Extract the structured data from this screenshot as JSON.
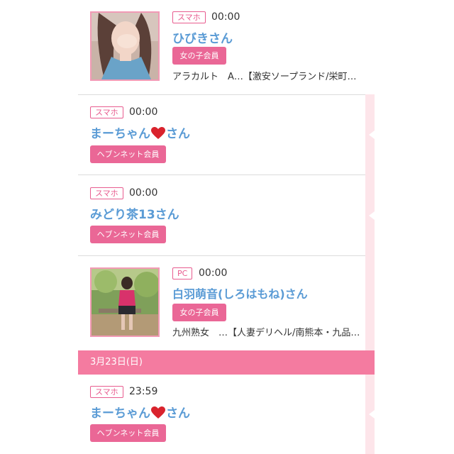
{
  "entries": [
    {
      "device": "スマホ",
      "time": "00:00",
      "name": "ひびきさん",
      "member_type": "女の子会員",
      "shop": "アラカルト　A…【激安ソープランド/栄町…"
    },
    {
      "device": "スマホ",
      "time": "00:00",
      "name_prefix": "まーちゃん",
      "name_suffix": "さん",
      "member_type": "ヘブンネット会員"
    },
    {
      "device": "スマホ",
      "time": "00:00",
      "name": "みどり茶13さん",
      "member_type": "ヘブンネット会員"
    },
    {
      "device": "PC",
      "time": "00:00",
      "name": "白羽萌音(しろはもね)さん",
      "member_type": "女の子会員",
      "shop": "九州熟女　…【人妻デリヘル/南熊本・九品…"
    }
  ],
  "date_header": "3月23日(日)",
  "entries_after_date": [
    {
      "device": "スマホ",
      "time": "23:59",
      "name_prefix": "まーちゃん",
      "name_suffix": "さん",
      "member_type": "ヘブンネット会員"
    }
  ],
  "colors": {
    "accent_pink": "#ea6796",
    "date_bar": "#f47ba0",
    "name_blue": "#5a9bd5",
    "heart_red": "#d9232d"
  },
  "icons": [
    "heart-emoji-icon"
  ]
}
